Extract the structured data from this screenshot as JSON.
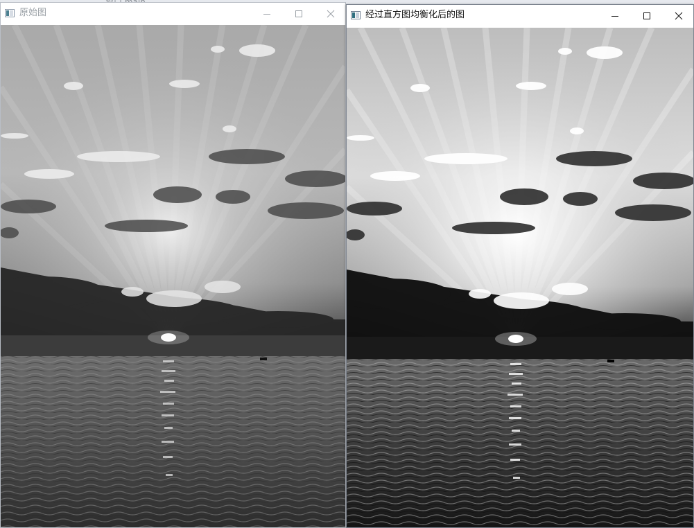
{
  "background_window": {
    "ghost_text": "…窗口 main"
  },
  "windows": [
    {
      "title": "原始图",
      "active": false,
      "controls": {
        "minimize": "minimize-icon",
        "maximize": "maximize-icon",
        "close": "close-icon"
      },
      "image": {
        "kind": "grayscale sunset over sea",
        "variant": "original"
      }
    },
    {
      "title": "经过直方图均衡化后的图",
      "active": true,
      "controls": {
        "minimize": "minimize-icon",
        "maximize": "maximize-icon",
        "close": "close-icon"
      },
      "image": {
        "kind": "grayscale sunset over sea",
        "variant": "histogram-equalized"
      }
    }
  ],
  "colors": {
    "inactive_title": "#9aa0a6",
    "active_title": "#111111",
    "desktop": "#cfd6df"
  }
}
